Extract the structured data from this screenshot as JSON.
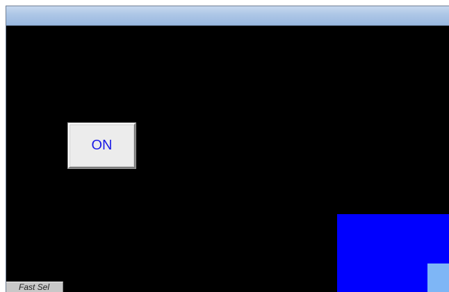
{
  "window": {
    "title": ""
  },
  "canvas": {
    "background": "#000000",
    "on_button": {
      "label": "ON",
      "text_color": "#1a1ae6"
    },
    "blue_panel_color": "#0000ff",
    "light_blue_box_color": "#7eb6f6"
  },
  "footer": {
    "fast_sel_label": "Fast Sel"
  }
}
